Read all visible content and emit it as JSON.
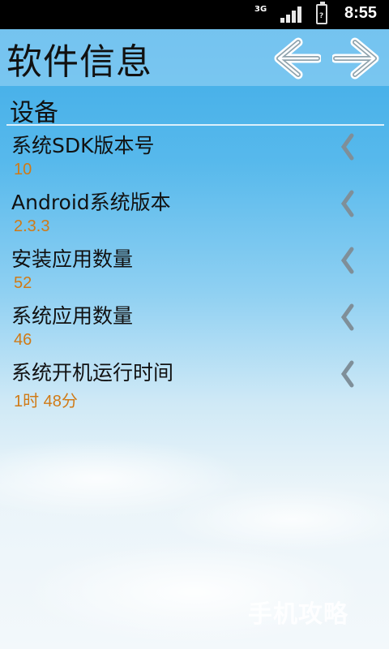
{
  "statusbar": {
    "network": "3G",
    "time": "8:55",
    "battery_icon": "battery-icon"
  },
  "header": {
    "title": "软件信息",
    "back_icon": "arrow-left-icon",
    "forward_icon": "arrow-right-icon"
  },
  "section": {
    "title": "设备"
  },
  "rows": [
    {
      "label": "系统SDK版本号",
      "value": "10"
    },
    {
      "label": "Android系统版本",
      "value": "2.3.3"
    },
    {
      "label": "安装应用数量",
      "value": "52"
    },
    {
      "label": "系统应用数量",
      "value": "46"
    },
    {
      "label": "系统开机运行时间",
      "value": "1时 48分"
    }
  ],
  "watermark": "手机攻略",
  "colors": {
    "value_text": "#d07a16",
    "sky_top": "#3aa9e6",
    "chevron": "#7f8f99"
  }
}
